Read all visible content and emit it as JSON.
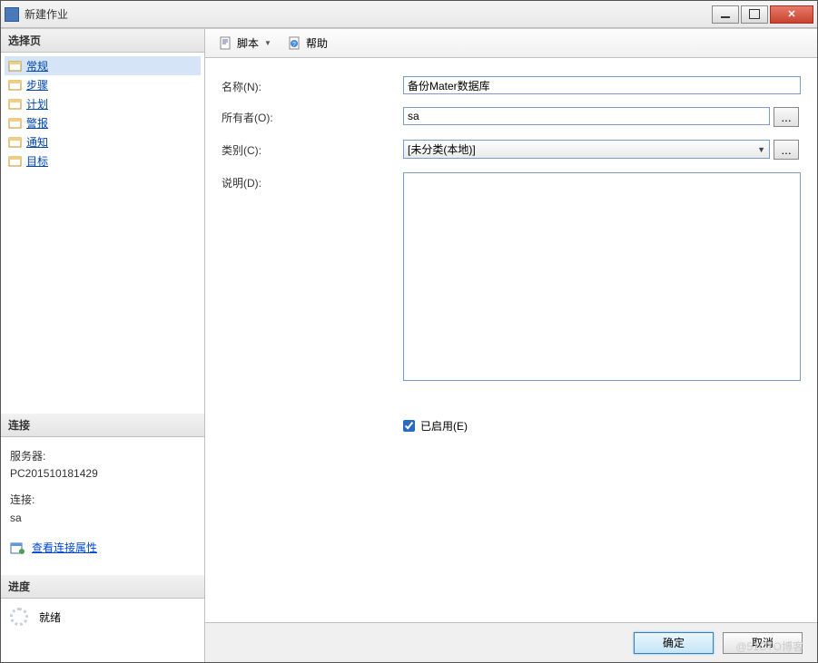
{
  "window": {
    "title": "新建作业"
  },
  "sidebar": {
    "select_page_header": "选择页",
    "items": [
      {
        "label": "常规"
      },
      {
        "label": "步骤"
      },
      {
        "label": "计划"
      },
      {
        "label": "警报"
      },
      {
        "label": "通知"
      },
      {
        "label": "目标"
      }
    ],
    "connection": {
      "header": "连接",
      "server_label": "服务器:",
      "server_value": "PC201510181429",
      "conn_label": "连接:",
      "conn_value": "sa",
      "view_props": "查看连接属性"
    },
    "progress": {
      "header": "进度",
      "status": "就绪"
    }
  },
  "toolbar": {
    "script_label": "脚本",
    "help_label": "帮助"
  },
  "form": {
    "name_label": "名称(N):",
    "name_value": "备份Mater数据库",
    "owner_label": "所有者(O):",
    "owner_value": "sa",
    "category_label": "类别(C):",
    "category_value": "[未分类(本地)]",
    "description_label": "说明(D):",
    "description_value": "",
    "enabled_label": "已启用(E)",
    "browse_label": "..."
  },
  "buttons": {
    "ok": "确定",
    "cancel": "取消"
  },
  "watermark": "@51CTO博客"
}
